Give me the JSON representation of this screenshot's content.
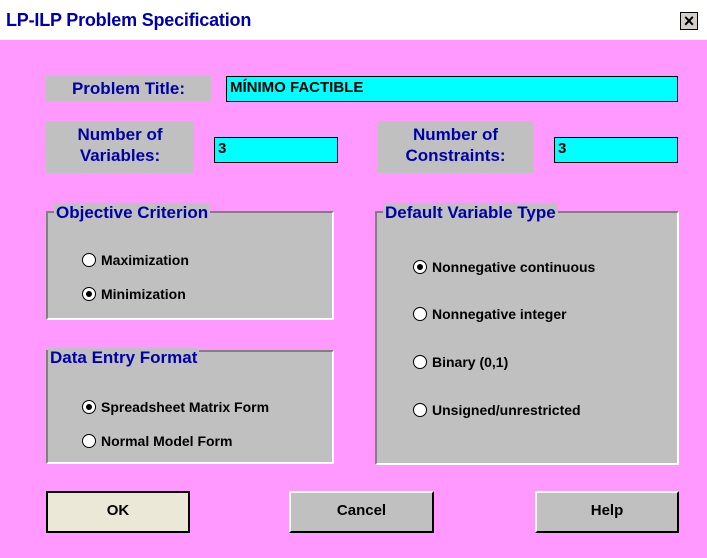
{
  "window": {
    "title": "LP-ILP Problem Specification",
    "close_glyph": "×"
  },
  "problem_title": {
    "label": "Problem Title:",
    "value": "MÍNIMO FACTIBLE"
  },
  "variables": {
    "label_line1": "Number of",
    "label_line2": "Variables:",
    "value": "3"
  },
  "constraints": {
    "label_line1": "Number of",
    "label_line2": "Constraints:",
    "value": "3"
  },
  "objective": {
    "title": "Objective Criterion",
    "options": [
      "Maximization",
      "Minimization"
    ],
    "selected": "Minimization"
  },
  "data_entry": {
    "title": "Data Entry Format",
    "options": [
      "Spreadsheet Matrix Form",
      "Normal Model Form"
    ],
    "selected": "Spreadsheet Matrix Form"
  },
  "variable_type": {
    "title": "Default Variable Type",
    "options": [
      "Nonnegative continuous",
      "Nonnegative integer",
      "Binary (0,1)",
      "Unsigned/unrestricted"
    ],
    "selected": "Nonnegative continuous"
  },
  "buttons": {
    "ok": "OK",
    "cancel": "Cancel",
    "help": "Help"
  },
  "colors": {
    "background": "#ff99ff",
    "input": "#00ffff",
    "label_text": "#0000aa",
    "panel": "#c0c0c0"
  }
}
